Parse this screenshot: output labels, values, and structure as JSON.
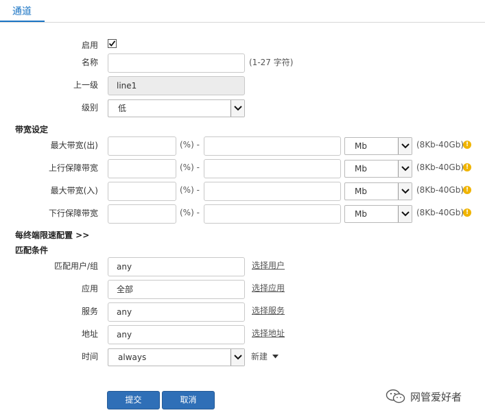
{
  "tab": {
    "title": "通道"
  },
  "form": {
    "enable": {
      "label": "启用",
      "checked": true
    },
    "name": {
      "label": "名称",
      "value": "",
      "hint": "(1-27 字符)"
    },
    "parent": {
      "label": "上一级",
      "value": "line1"
    },
    "level": {
      "label": "级别",
      "value": "低"
    }
  },
  "bandwidth": {
    "section_title": "带宽设定",
    "rows": [
      {
        "label": "最大带宽(出)",
        "percent": "(%) -",
        "unit": "Mb",
        "range": "(8Kb-40Gb)"
      },
      {
        "label": "上行保障带宽",
        "percent": "(%) -",
        "unit": "Mb",
        "range": "(8Kb-40Gb)"
      },
      {
        "label": "最大带宽(入)",
        "percent": "(%) -",
        "unit": "Mb",
        "range": "(8Kb-40Gb)"
      },
      {
        "label": "下行保障带宽",
        "percent": "(%) -",
        "unit": "Mb",
        "range": "(8Kb-40Gb)"
      }
    ],
    "per_terminal": "每终端限速配置 >>"
  },
  "match": {
    "section_title": "匹配条件",
    "user": {
      "label": "匹配用户/组",
      "value": "any",
      "link": "选择用户"
    },
    "app": {
      "label": "应用",
      "value": "全部",
      "link": "选择应用"
    },
    "service": {
      "label": "服务",
      "value": "any",
      "link": "选择服务"
    },
    "address": {
      "label": "地址",
      "value": "any",
      "link": "选择地址"
    },
    "time": {
      "label": "时间",
      "value": "always",
      "new_label": "新建"
    }
  },
  "buttons": {
    "submit": "提交",
    "cancel": "取消"
  },
  "watermark": {
    "text": "网管爱好者"
  },
  "colors": {
    "accent": "#1a74c4",
    "button": "#2f6fb7",
    "warning": "#f0b400"
  }
}
